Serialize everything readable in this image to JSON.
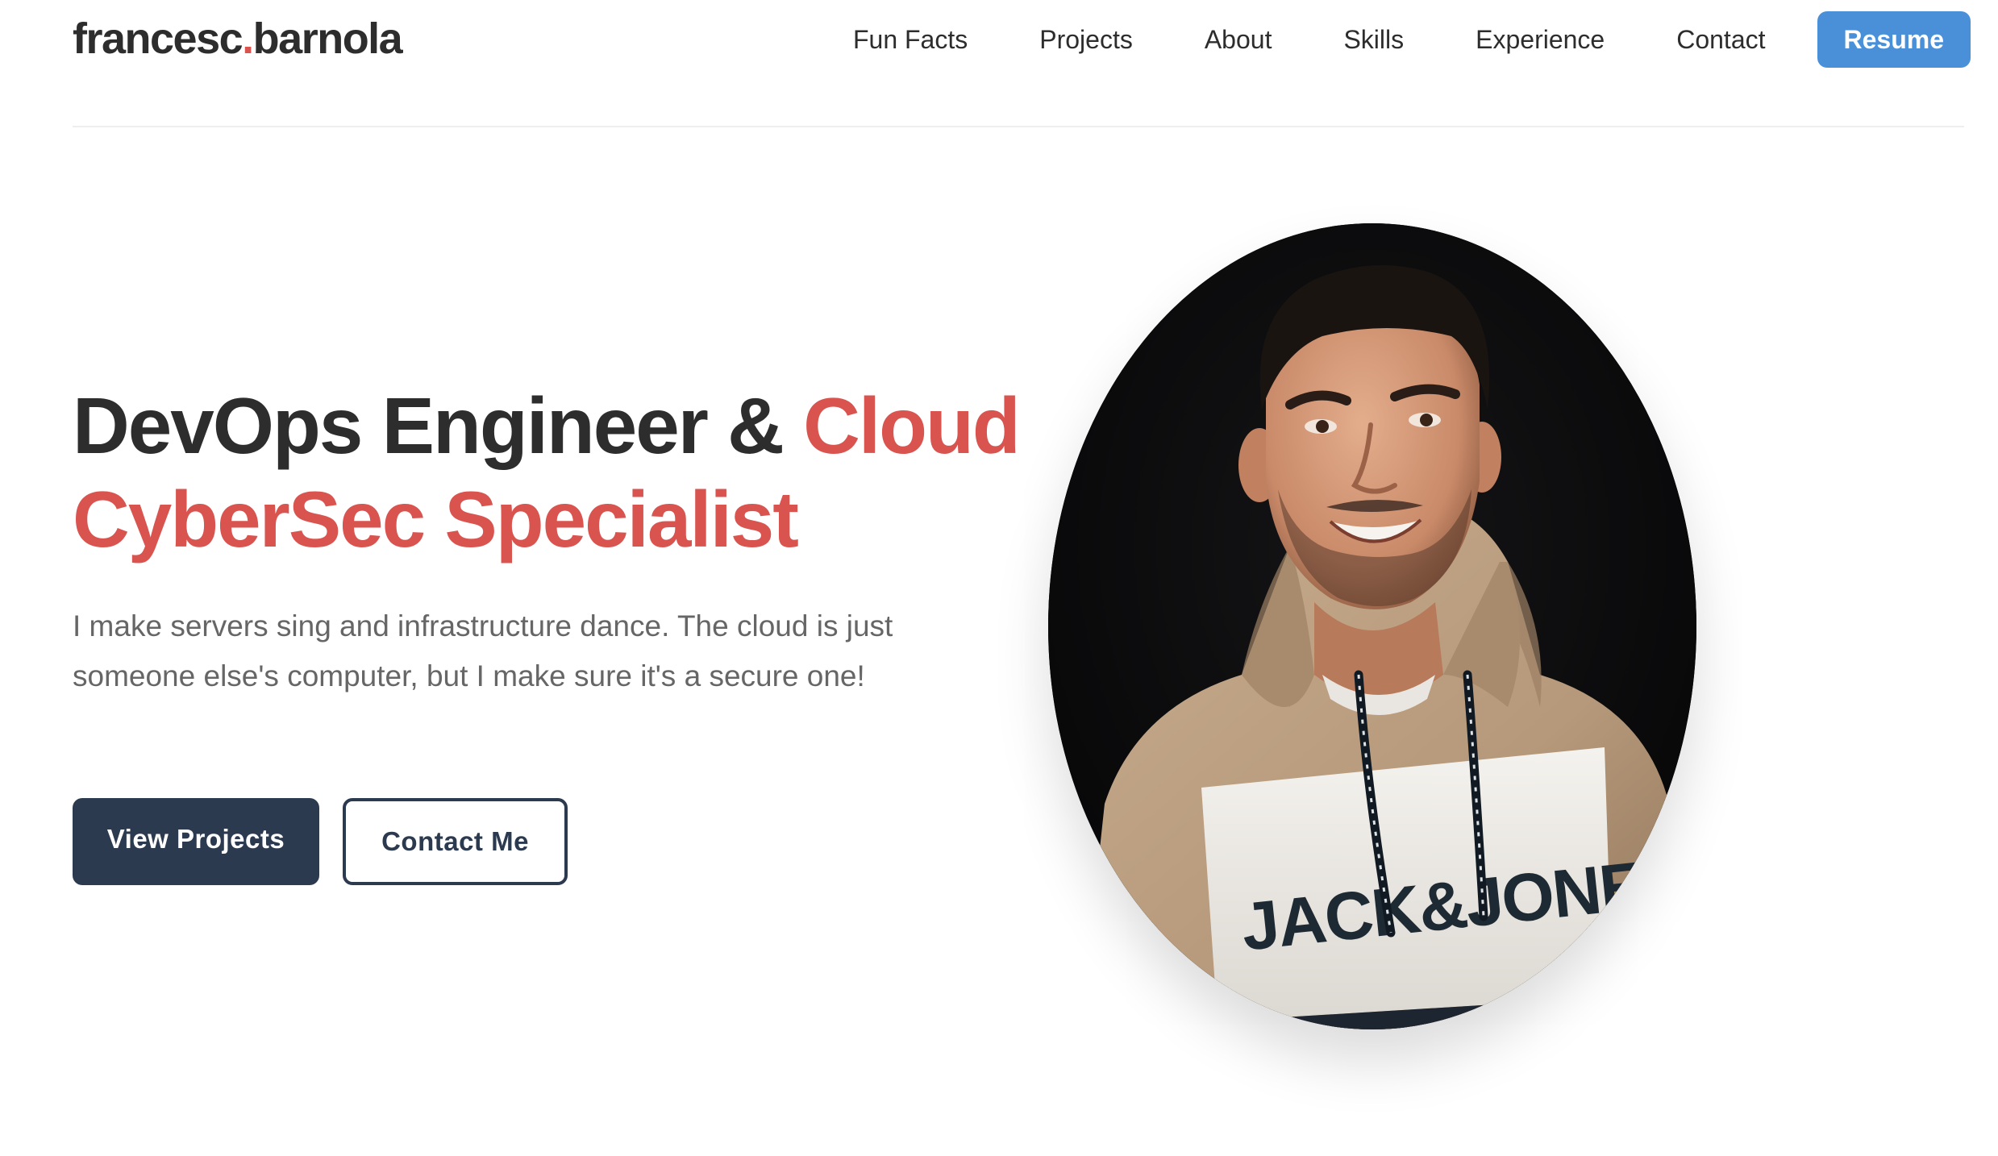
{
  "logo": {
    "part1": "francesc",
    "dot": ".",
    "part2": "barnola"
  },
  "nav": {
    "items": [
      {
        "label": "Fun Facts"
      },
      {
        "label": "Projects"
      },
      {
        "label": "About"
      },
      {
        "label": "Skills"
      },
      {
        "label": "Experience"
      },
      {
        "label": "Contact"
      }
    ],
    "resume_label": "Resume"
  },
  "hero": {
    "title_plain": "DevOps Engineer & ",
    "title_accent": "Cloud CyberSec Specialist",
    "description": "I make servers sing and infrastructure dance. The cloud is just someone else's computer, but I make sure it's a secure one!",
    "primary_button": "View Projects",
    "secondary_button": "Contact Me"
  },
  "portrait": {
    "hoodie_brand": "JACK&JONES"
  },
  "colors": {
    "accent": "#d9534f",
    "resume_button": "#4a90d9",
    "dark_button": "#2c3a4f",
    "text": "#2d2d2d",
    "muted_text": "#666666"
  }
}
